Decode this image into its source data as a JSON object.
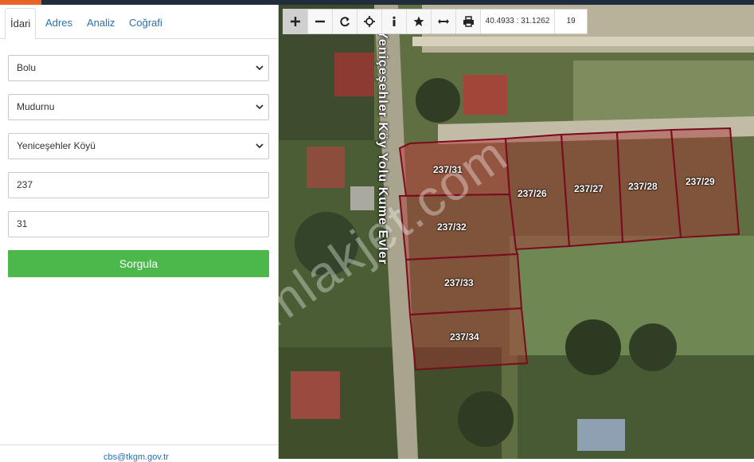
{
  "tabs": [
    {
      "label": "İdari"
    },
    {
      "label": "Adres"
    },
    {
      "label": "Analiz"
    },
    {
      "label": "Coğrafi"
    }
  ],
  "form": {
    "province": "Bolu",
    "district": "Mudurnu",
    "village": "Yeniceşehler Köyü",
    "block": "237",
    "parcel": "31",
    "submit_label": "Sorgula"
  },
  "footer": {
    "email": "cbs@tkgm.gov.tr"
  },
  "map": {
    "coordinates": "40.4933 : 31.1262",
    "zoom": "19",
    "road_name": "Yeniçeşehler Köy Yolu Kume Evler",
    "watermark": "emlakjet.com",
    "parcels": [
      {
        "label": "237/31"
      },
      {
        "label": "237/26"
      },
      {
        "label": "237/27"
      },
      {
        "label": "237/28"
      },
      {
        "label": "237/29"
      },
      {
        "label": "237/32"
      },
      {
        "label": "237/33"
      },
      {
        "label": "237/34"
      }
    ]
  },
  "toolbar_icons": [
    "zoom-in-icon",
    "zoom-out-icon",
    "refresh-icon",
    "locate-icon",
    "info-icon",
    "star-icon",
    "measure-icon",
    "print-icon"
  ],
  "colors": {
    "accent": "#e8622a",
    "submit": "#4cb84c",
    "parcel_border": "#7a0a1e",
    "parcel_fill": "#b03030"
  }
}
